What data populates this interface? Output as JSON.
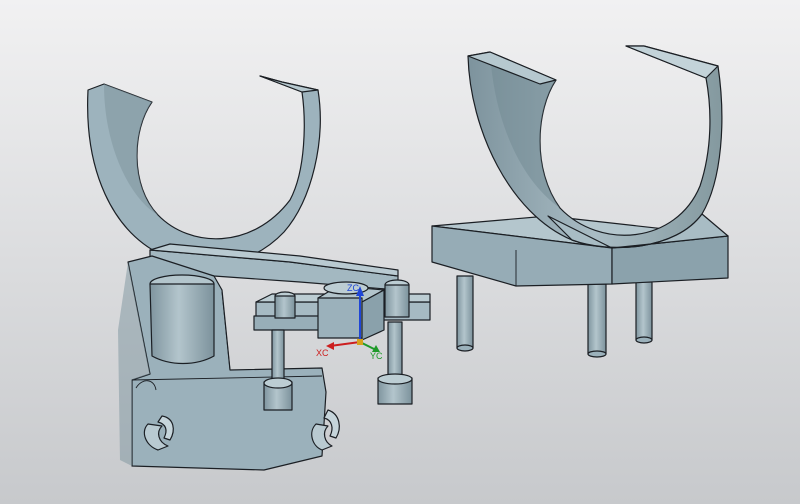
{
  "viewport": {
    "background_top": "#f1f1f2",
    "background_bottom": "#c7c9cc",
    "part_color": "#9cb2bc",
    "part_shadow": "#6e858f",
    "part_light": "#b8c9d0",
    "edge_color": "#1b1f24"
  },
  "csys": {
    "x_label": "XC",
    "y_label": "YC",
    "z_label": "ZC",
    "x_color": "#cc1f1f",
    "y_color": "#1f9a2a",
    "z_color": "#1f46d6",
    "origin_color": "#d7a21b"
  }
}
